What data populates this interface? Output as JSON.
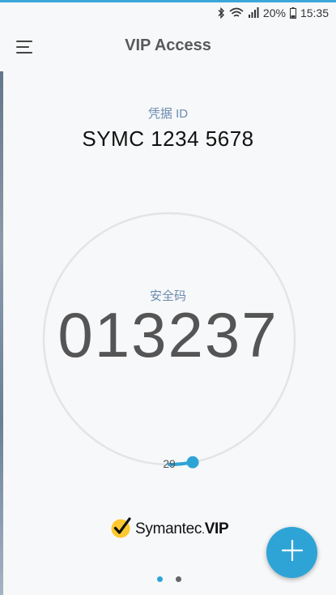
{
  "colors": {
    "accent": "#2ea4d6",
    "label": "#6b8bb0",
    "dot_active": "#2ea4d6",
    "dot_inactive": "#666666"
  },
  "status_bar": {
    "icons": [
      "bluetooth-icon",
      "wifi-icon",
      "signal-icon",
      "battery-icon"
    ],
    "battery": "20%",
    "time": "15:35"
  },
  "app_bar": {
    "menu_icon": "hamburger-menu-icon",
    "title": "VIP Access"
  },
  "credential": {
    "label": "凭据 ID",
    "id": "SYMC 1234 5678"
  },
  "security_code": {
    "label": "安全码",
    "code": "013237",
    "seconds_remaining": "29",
    "progress_fraction": 0.97
  },
  "brand": {
    "logo_icon": "symantec-checkmark-logo-icon",
    "name": "Symantec",
    "product": "VIP"
  },
  "fab": {
    "icon": "plus-icon"
  },
  "pager": {
    "pages": 2,
    "active": 0
  }
}
